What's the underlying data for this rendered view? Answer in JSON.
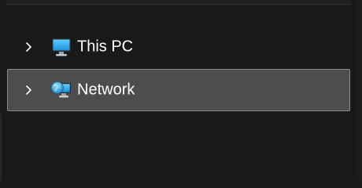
{
  "navigation_pane": {
    "items": [
      {
        "label": "This PC",
        "icon": "monitor-icon",
        "expand_icon": "chevron-right-icon",
        "selected": false
      },
      {
        "label": "Network",
        "icon": "network-globe-icon",
        "expand_icon": "chevron-right-icon",
        "selected": true
      }
    ]
  },
  "colors": {
    "background": "#191919",
    "selected_background": "#4d4d4d",
    "selected_border": "#8a8a8a",
    "text": "#ffffff",
    "accent_blue": "#3aa3e0"
  }
}
